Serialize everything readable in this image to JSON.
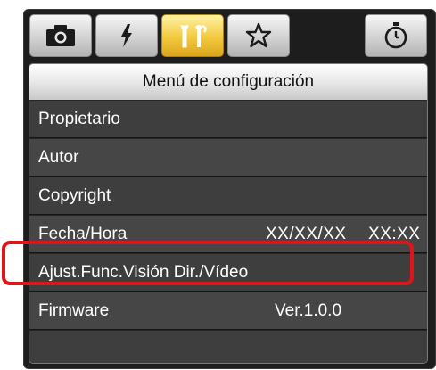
{
  "tabs": [
    {
      "icon": "camera-icon",
      "active": false
    },
    {
      "icon": "flash-icon",
      "active": false
    },
    {
      "icon": "setup-tools-icon",
      "active": true
    },
    {
      "icon": "my-menu-star-icon",
      "active": false
    },
    {
      "icon": "timer-icon",
      "active": false
    }
  ],
  "menu": {
    "title": "Menú de configuración",
    "items": [
      {
        "label": "Propietario",
        "value": ""
      },
      {
        "label": "Autor",
        "value": ""
      },
      {
        "label": "Copyright",
        "value": ""
      },
      {
        "label": "Fecha/Hora",
        "date": "XX/XX/XX",
        "time": "XX:XX"
      },
      {
        "label": "Ajust.Func.Visión Dir./Vídeo",
        "value": ""
      },
      {
        "label": "Firmware",
        "value": "Ver.1.0.0"
      }
    ]
  },
  "colors": {
    "highlight": "#e0141b",
    "active_tab": "#f2c93d",
    "panel_bg": "#262626"
  }
}
